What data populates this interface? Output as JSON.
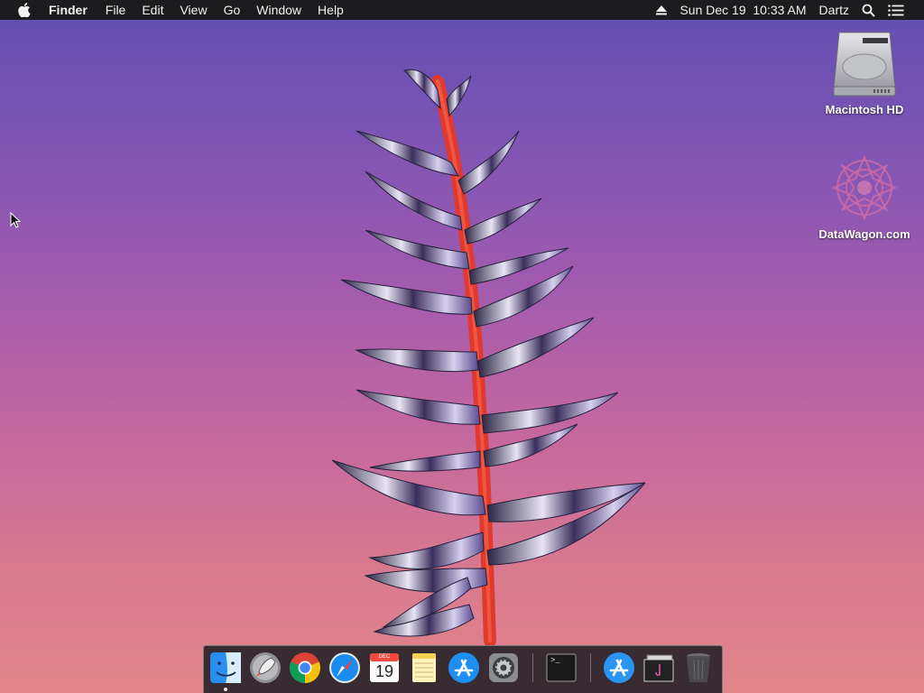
{
  "menubar": {
    "apple_icon": "apple-logo-icon",
    "app_name": "Finder",
    "menus": [
      "File",
      "Edit",
      "View",
      "Go",
      "Window",
      "Help"
    ],
    "status": {
      "eject_icon": "eject-icon",
      "clock": "Sun Dec 19  10:33 AM",
      "user": "Dartz",
      "search_icon": "spotlight-search-icon",
      "list_icon": "notification-center-icon"
    }
  },
  "desktop_icons": [
    {
      "label": "Macintosh HD",
      "icon": "hard-drive-icon"
    },
    {
      "label": "DataWagon.com",
      "icon": "datawagon-logo-icon"
    }
  ],
  "dock": {
    "apps": [
      {
        "name": "Finder",
        "icon": "finder-icon",
        "running": true
      },
      {
        "name": "Launchpad",
        "icon": "launchpad-icon"
      },
      {
        "name": "Google Chrome",
        "icon": "chrome-icon"
      },
      {
        "name": "Safari",
        "icon": "safari-icon"
      },
      {
        "name": "Calendar",
        "icon": "calendar-icon",
        "month": "DEC",
        "day": "19"
      },
      {
        "name": "Notes",
        "icon": "notes-icon"
      },
      {
        "name": "App Store",
        "icon": "app-store-icon"
      },
      {
        "name": "System Preferences",
        "icon": "system-preferences-icon"
      },
      {
        "name": "Terminal",
        "icon": "terminal-icon",
        "prompt": ">_"
      },
      {
        "name": "Applications",
        "icon": "applications-folder-icon"
      },
      {
        "name": "Downloads",
        "icon": "downloads-stack-icon"
      },
      {
        "name": "Trash",
        "icon": "trash-icon"
      }
    ]
  },
  "colors": {
    "menubar_bg": "#1c1b1d",
    "wallpaper_top": "#5f4fb1",
    "wallpaper_bottom": "#e2868a",
    "plant_stem": "#e0392f"
  }
}
